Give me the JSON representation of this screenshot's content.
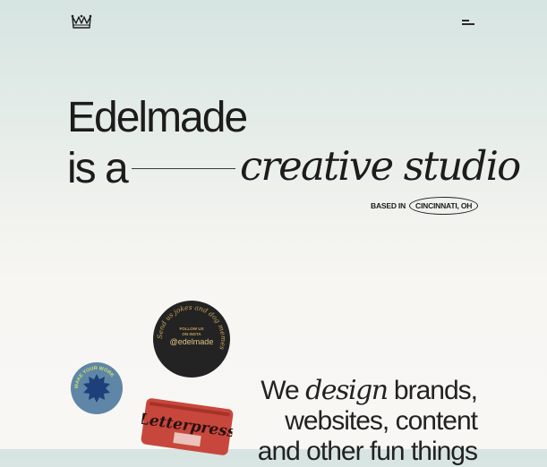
{
  "header": {
    "logo_icon": "crown-icon",
    "menu_icon": "hamburger-menu-icon"
  },
  "hero": {
    "line1": "Edelmade",
    "line2_prefix": "is a",
    "line2_italic": "creative studio",
    "based_label": "BASED IN",
    "city": "CINCINNATI, OH"
  },
  "stickers": {
    "dark_ring_text": "Send us jokes and dog memes",
    "dark_follow": "FOLLOW US",
    "dark_on": "ON INSTA",
    "dark_handle": "@edelmade",
    "blue_ring_text": "MAKE YOUR WORK",
    "red_text": "Letterpress"
  },
  "tagline": {
    "pre": "We",
    "italic": "design",
    "post": "brands,",
    "line2": "websites, content",
    "line3": "and other fun things"
  },
  "colors": {
    "dark_sticker": "#232323",
    "blue_sticker": "#5f86a6",
    "red_sticker": "#c8473c",
    "gold_text": "#c9a15a"
  }
}
